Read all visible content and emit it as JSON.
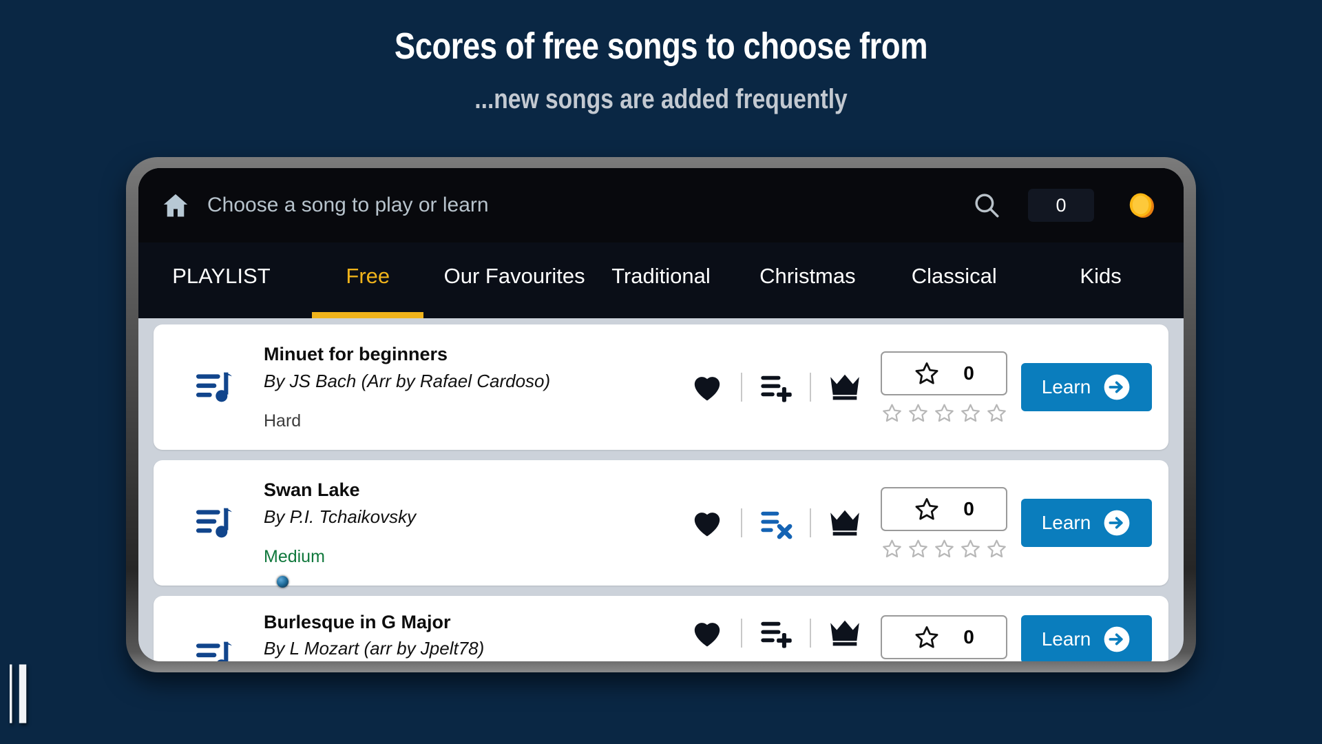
{
  "promo": {
    "headline": "Scores of free songs to choose from",
    "subhead": "...new songs are added frequently",
    "logo_icon": "bass-clef-icon",
    "bg_color": "#0a2744"
  },
  "appbar": {
    "home_icon": "home-icon",
    "title": "Choose a song to play or learn",
    "search_icon": "search-icon",
    "coin_count": "0",
    "coin_icon": "coin-icon"
  },
  "tabs": [
    {
      "label": "PLAYLIST",
      "active": false
    },
    {
      "label": "Free",
      "active": true
    },
    {
      "label": "Our Favourites",
      "active": false
    },
    {
      "label": "Traditional",
      "active": false
    },
    {
      "label": "Christmas",
      "active": false
    },
    {
      "label": "Classical",
      "active": false
    },
    {
      "label": "Kids",
      "active": false
    }
  ],
  "accent_color": "#f0b31b",
  "learn_button_color": "#0a7dbd",
  "songs": [
    {
      "title": "Minuet for beginners",
      "artist": "By JS Bach (Arr by Rafael Cardoso)",
      "difficulty": "Hard",
      "difficulty_color": "#3c3c3c",
      "favourite_icon": "heart-filled-icon",
      "playlist_icon": "playlist-add-icon",
      "premium_icon": "crown-icon",
      "rating_count": "0",
      "stars_filled": 0,
      "learn_label": "Learn"
    },
    {
      "title": "Swan Lake",
      "artist": "By P.I. Tchaikovsky",
      "difficulty": "Medium",
      "difficulty_color": "#10783c",
      "favourite_icon": "heart-filled-icon",
      "playlist_icon": "playlist-remove-icon",
      "premium_icon": "crown-icon",
      "rating_count": "0",
      "stars_filled": 0,
      "learn_label": "Learn"
    },
    {
      "title": "Burlesque in G Major",
      "artist": "By L Mozart (arr by Jpelt78)",
      "difficulty": "",
      "difficulty_color": "#3c3c3c",
      "favourite_icon": "heart-filled-icon",
      "playlist_icon": "playlist-add-icon",
      "premium_icon": "crown-icon",
      "rating_count": "0",
      "stars_filled": 0,
      "learn_label": "Learn"
    }
  ]
}
